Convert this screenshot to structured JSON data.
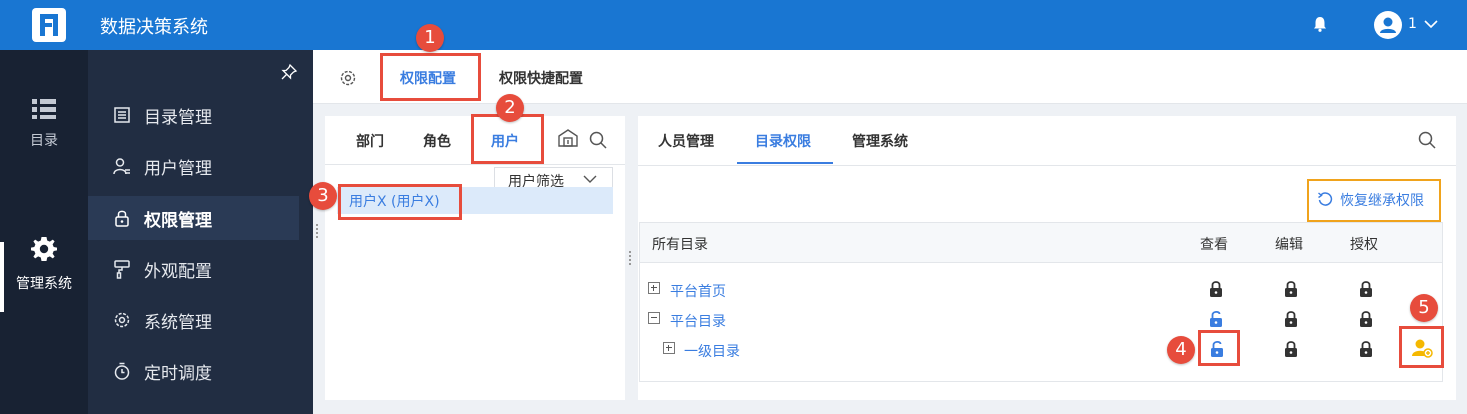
{
  "header": {
    "app_title": "数据决策系统",
    "user_name": "1"
  },
  "rail": {
    "items": [
      {
        "label": "目录",
        "icon": "list-icon"
      },
      {
        "label": "管理系统",
        "icon": "gear-icon",
        "active": true
      }
    ]
  },
  "sidebar": {
    "items": [
      {
        "label": "目录管理",
        "icon": "catalog-icon"
      },
      {
        "label": "用户管理",
        "icon": "user-manage-icon"
      },
      {
        "label": "权限管理",
        "icon": "lock-icon",
        "active": true
      },
      {
        "label": "外观配置",
        "icon": "paint-roller-icon"
      },
      {
        "label": "系统管理",
        "icon": "settings-icon"
      },
      {
        "label": "定时调度",
        "icon": "timer-icon"
      }
    ]
  },
  "main_tabs": [
    {
      "label": "权限配置",
      "active": true
    },
    {
      "label": "权限快捷配置",
      "active": false
    }
  ],
  "left_panel": {
    "tabs": [
      {
        "label": "部门",
        "active": false
      },
      {
        "label": "角色",
        "active": false
      },
      {
        "label": "用户",
        "active": true
      }
    ],
    "filter_label": "用户筛选",
    "users": [
      "用户X (用户X)"
    ]
  },
  "right_panel": {
    "tabs": [
      {
        "label": "人员管理",
        "active": false
      },
      {
        "label": "目录权限",
        "active": true
      },
      {
        "label": "管理系统",
        "active": false
      }
    ],
    "restore_label": "恢复继承权限",
    "table": {
      "columns": [
        "所有目录",
        "查看",
        "编辑",
        "授权"
      ],
      "rows": [
        {
          "label": "平台首页",
          "expander": "plus",
          "level": 0,
          "view": "locked",
          "edit": "locked",
          "grant": "locked"
        },
        {
          "label": "平台目录",
          "expander": "minus",
          "level": 0,
          "view": "unlocked",
          "edit": "locked",
          "grant": "locked"
        },
        {
          "label": "一级目录",
          "expander": "plus",
          "level": 1,
          "view": "unlocked",
          "edit": "locked",
          "grant": "locked"
        }
      ]
    }
  },
  "callouts": [
    "1",
    "2",
    "3",
    "4",
    "5"
  ],
  "colors": {
    "topbar": "#1976d2",
    "rail": "#182233",
    "sidebar": "#212d42",
    "accent": "#3a7de0",
    "callout": "#e74c3c",
    "highlight_orange": "#f0a31c",
    "inherit_icon": "#f5b800"
  }
}
